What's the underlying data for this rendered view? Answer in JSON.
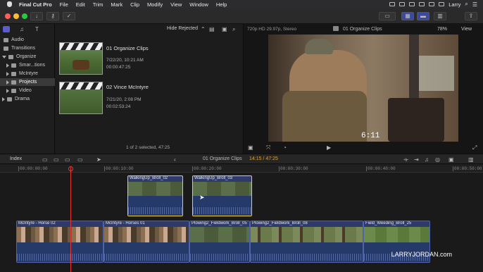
{
  "menubar": {
    "items": [
      "Final Cut Pro",
      "File",
      "Edit",
      "Trim",
      "Mark",
      "Clip",
      "Modify",
      "View",
      "Window",
      "Help"
    ],
    "user": "Larry"
  },
  "sidebar": {
    "items": [
      {
        "label": "Audio"
      },
      {
        "label": "Transitions"
      },
      {
        "label": "Organize"
      },
      {
        "label": "Smar...tions"
      },
      {
        "label": "McIntyre"
      },
      {
        "label": "Projects"
      },
      {
        "label": "Video"
      },
      {
        "label": "Drama"
      }
    ]
  },
  "browser": {
    "filter": "Hide Rejected",
    "clips": [
      {
        "title": "01 Organize Clips",
        "date": "7/22/20, 10:21 AM",
        "duration": "00:00:47:25"
      },
      {
        "title": "02 Vince McIntyre",
        "date": "7/21/20, 2:08 PM",
        "duration": "00:02:53:24"
      }
    ],
    "status": "1 of 2 selected, 47:25"
  },
  "viewer": {
    "format": "720p HD 29.97p, Stereo",
    "title": "01 Organize Clips",
    "zoom": "78%",
    "view_label": "View",
    "timecode": "6:11"
  },
  "timeline_header": {
    "index_label": "Index",
    "project": "01 Organize Clips",
    "duration": "14:15 / 47:25"
  },
  "ruler": [
    "00:00:00:00",
    "00:00:10:00",
    "00:00:20:00",
    "00:00:30:00",
    "00:00:40:00",
    "00:00:50:00"
  ],
  "connected_clips": [
    "WalkingUp_Broll_02",
    "WalkingUp_Broll_03"
  ],
  "primary_clips": [
    "McIntyre - Horse 02",
    "McIntyre - Horses 01",
    "Plowing2_Fieldwork_Broll_05",
    "Plowing2_Fieldwork_Broll_08",
    "Field_Weeding_Broll_25"
  ],
  "watermark": "LARRYJORDAN.com",
  "colors": {
    "selected_outline": "#f1d13a",
    "playhead": "#e33333",
    "clip_blue": "#2e3b6a"
  }
}
